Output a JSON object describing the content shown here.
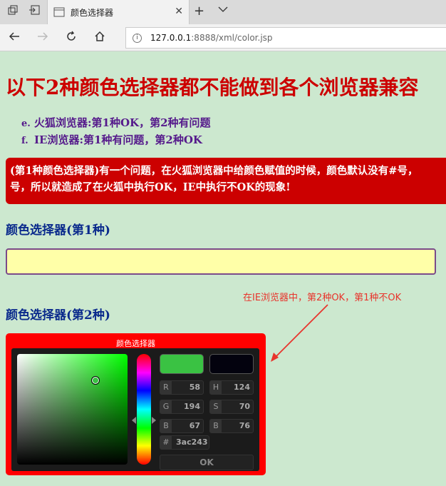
{
  "browser": {
    "tab_title": "颜色选择器",
    "url_host": "127.0.0.1",
    "url_path": ":8888/xml/color.jsp"
  },
  "page": {
    "heading": "以下2种颜色选择器都不能做到各个浏览器兼容",
    "list": [
      {
        "marker": "e.",
        "text": "火狐浏览器:第1种OK，第2种有问题"
      },
      {
        "marker": "f.",
        "text": "IE浏览器:第1种有问题，第2种OK"
      }
    ],
    "alert_line1": "(第1种颜色选择器)有一个问题，在火狐浏览器中给颜色赋值的时候，颜色默认没有#号，",
    "alert_line2": "号，所以就造成了在火狐中执行OK，IE中执行不OK的现象!",
    "section1": "颜色选择器(第1种)",
    "section2": "颜色选择器(第2种)",
    "annotation": "在IE浏览器中，第2种OK，第1种不OK"
  },
  "picker": {
    "title": "颜色选择器",
    "new_color": "#3ac243",
    "old_color": "#03020e",
    "r_label": "R",
    "r_value": "58",
    "g_label": "G",
    "g_value": "194",
    "b_label": "B",
    "b_value": "67",
    "h_label": "H",
    "h_value": "124",
    "s_label": "S",
    "s_value": "70",
    "v_label": "B",
    "v_value": "76",
    "hex_label": "#",
    "hex_value": "3ac243",
    "ok_label": "OK"
  }
}
